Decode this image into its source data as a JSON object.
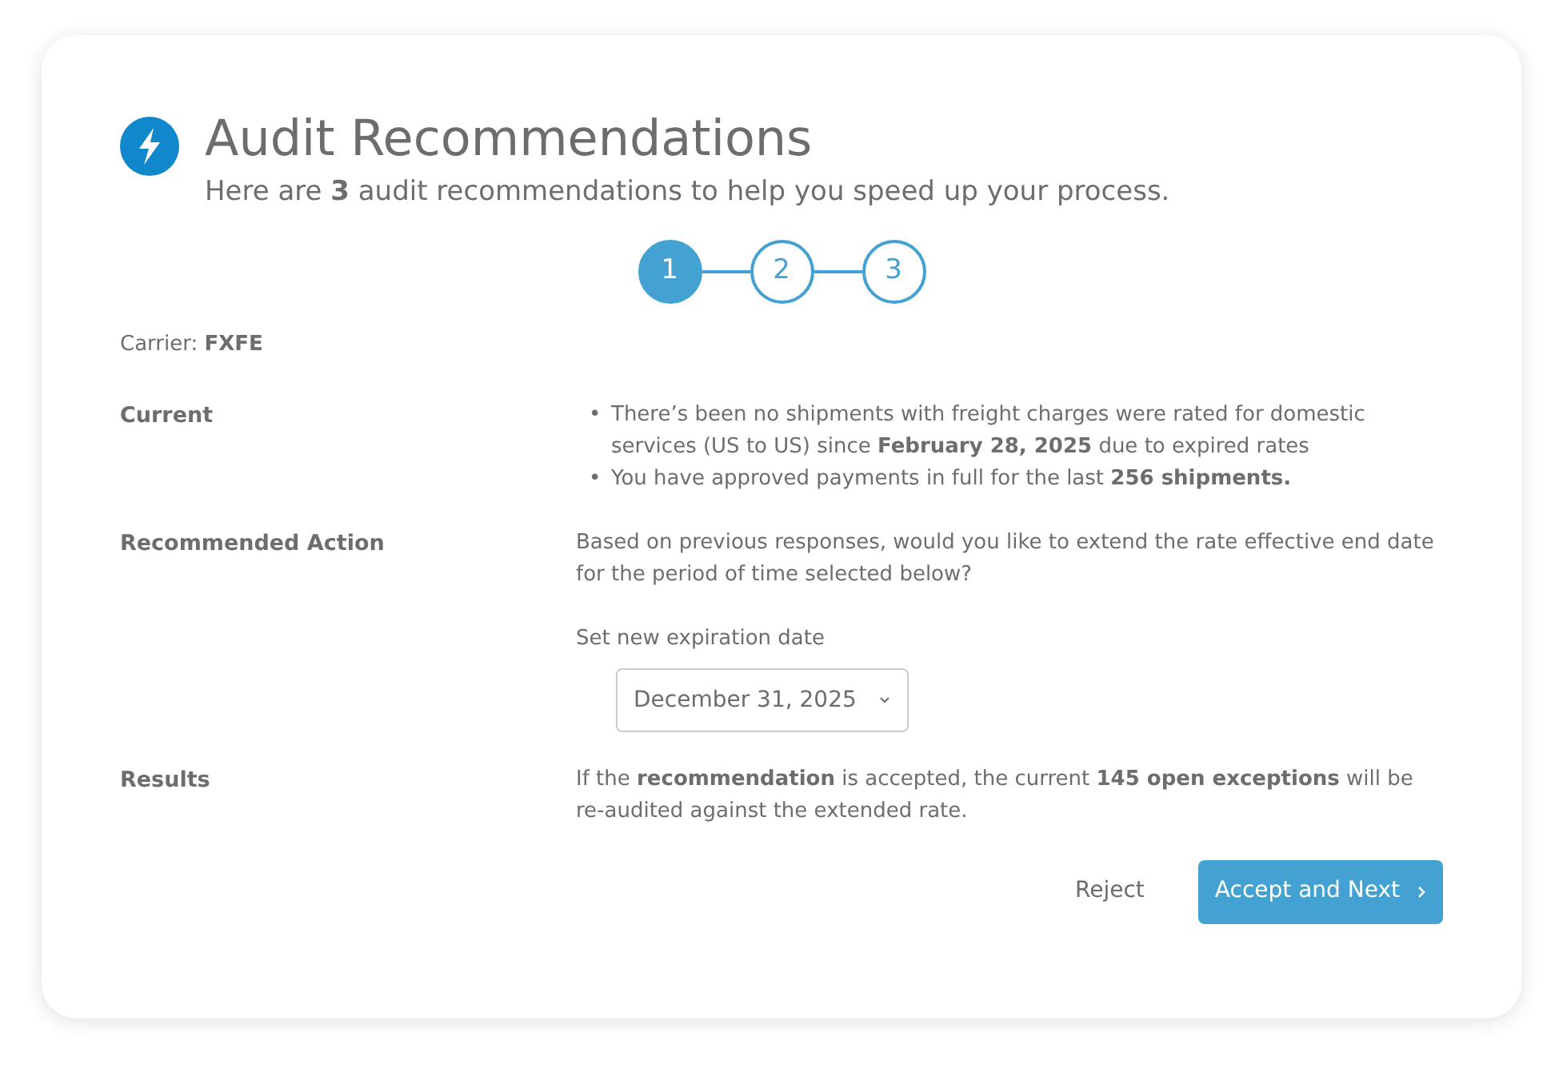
{
  "header": {
    "title": "Audit Recommendations",
    "subtitle": "Here are **3** audit recommendations to help you speed up your process."
  },
  "steps": [
    {
      "label": "1",
      "selected": true
    },
    {
      "label": "2",
      "selected": false
    },
    {
      "label": "3",
      "selected": false
    }
  ],
  "carrier": "Carrier: **FXFE**",
  "sections": [
    {
      "kind": "bullets",
      "label": "Current",
      "items": [
        {
          "marker": "•",
          "text": "There’s been no shipments with freight charges  were rated for domestic services (US to US) since **February 28, 2025** due to expired rates"
        },
        {
          "marker": "•",
          "text": "You have approved payments in full for the last **256 shipments.**"
        }
      ]
    },
    {
      "kind": "action",
      "label": "Recommended Action",
      "text": "Based on previous responses, would you like to extend the rate effective end date for the period of time selected below?",
      "field_label": "Set new expiration date",
      "value": "December 31, 2025"
    },
    {
      "kind": "text",
      "label": "Results",
      "text": "If the **recommendation** is accepted, the current **145 open exceptions** will be re-audited against the extended rate."
    }
  ],
  "buttons": {
    "reject": "Reject",
    "accept": "Accept and Next"
  }
}
